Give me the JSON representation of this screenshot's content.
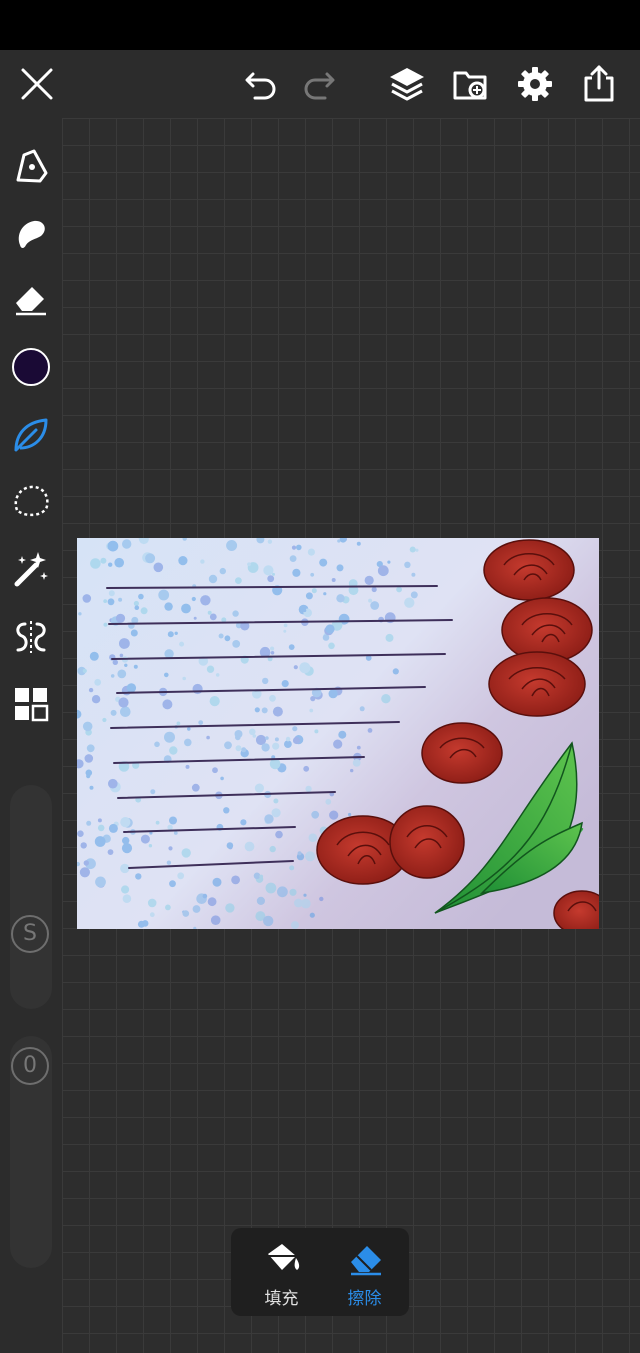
{
  "toolbar": {
    "close": "close-icon",
    "undo": "undo-icon",
    "redo": "redo-icon",
    "layers": "layers-icon",
    "import": "import-icon",
    "settings": "gear-icon",
    "share": "share-icon"
  },
  "tools": [
    {
      "name": "pen-icon"
    },
    {
      "name": "smudge-icon"
    },
    {
      "name": "eraser-icon"
    },
    {
      "name": "color-swatch",
      "color": "#1a0a35"
    },
    {
      "name": "leaf-icon",
      "active": true
    },
    {
      "name": "lasso-icon"
    },
    {
      "name": "magic-wand-icon"
    },
    {
      "name": "symmetry-icon"
    },
    {
      "name": "grid-icon"
    }
  ],
  "sliders": {
    "size_label": "S",
    "opacity_label": "0"
  },
  "bottom_panel": {
    "fill_label": "填充",
    "erase_label": "擦除",
    "active": "erase"
  },
  "colors": {
    "accent": "#2b8de8",
    "icon": "#ffffff",
    "active_color_swatch": "#1a0a35"
  }
}
